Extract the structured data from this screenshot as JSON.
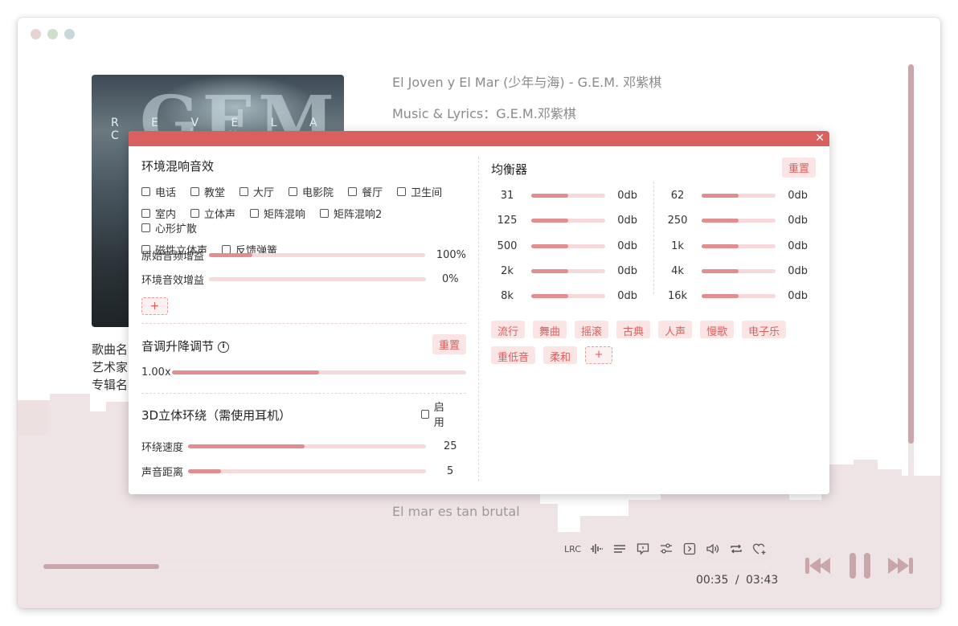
{
  "window": {
    "traffic_colors": [
      "#e8d3d3",
      "#cde0c9",
      "#c5d8dc"
    ]
  },
  "cover": {
    "text": "R E V E L A C I Ó N",
    "big_text": "GEM"
  },
  "track_info": {
    "song_label": "歌曲名",
    "artist_label": "艺术家",
    "album_label": "专辑名"
  },
  "lyrics": {
    "title_line": "El Joven y El Mar (少年与海) - G.E.M. 邓紫棋",
    "credit_line": "Music & Lyrics：G.E.M.邓紫棋",
    "current_line": "El mar es tan brutal"
  },
  "toolbar": {
    "lrc_label": "LRC",
    "icons": [
      "waveform-icon",
      "lines-icon",
      "comment-icon",
      "sliders-icon",
      "chevron-box-icon",
      "volume-icon",
      "repeat-icon",
      "heart-add-icon"
    ]
  },
  "playback": {
    "progress": 0.16,
    "current_time": "00:35",
    "separator": "/",
    "total_time": "03:43",
    "prev_label": "previous",
    "pause_label": "pause",
    "next_label": "next"
  },
  "colors": {
    "accent": "#d9605f",
    "accent_light": "#fbe4e4",
    "slider_fill": "#e28d8f",
    "track": "#f6d9da",
    "muted": "#c9a6aa"
  },
  "dialog": {
    "ambient": {
      "title": "环境混响音效",
      "effects": [
        [
          "电话",
          "教堂",
          "大厅",
          "电影院",
          "餐厅",
          "卫生间"
        ],
        [
          "室内",
          "立体声",
          "矩阵混响",
          "矩阵混响2",
          "心形扩散"
        ],
        [
          "磁性立体声",
          "反馈弹簧"
        ]
      ],
      "original_gain_label": "原始音频增益",
      "original_gain_value": "100%",
      "original_gain": 0.2,
      "effect_gain_label": "环境音效增益",
      "effect_gain_value": "0%",
      "effect_gain": 0,
      "add_label": "+"
    },
    "pitch": {
      "title": "音调升降调节",
      "info_glyph": "i",
      "reset_label": "重置",
      "value_label": "1.00x",
      "level": 0.5
    },
    "surround": {
      "title": "3D立体环绕（需使用耳机）",
      "enable_label": "启用",
      "speed_label": "环绕速度",
      "speed_value": "25",
      "speed_level": 0.49,
      "distance_label": "声音距离",
      "distance_value": "5",
      "distance_level": 0.14
    },
    "equalizer": {
      "title": "均衡器",
      "reset_label": "重置",
      "left": [
        {
          "freq": "31",
          "value": "0db"
        },
        {
          "freq": "125",
          "value": "0db"
        },
        {
          "freq": "500",
          "value": "0db"
        },
        {
          "freq": "2k",
          "value": "0db"
        },
        {
          "freq": "8k",
          "value": "0db"
        }
      ],
      "right": [
        {
          "freq": "62",
          "value": "0db"
        },
        {
          "freq": "250",
          "value": "0db"
        },
        {
          "freq": "1k",
          "value": "0db"
        },
        {
          "freq": "4k",
          "value": "0db"
        },
        {
          "freq": "16k",
          "value": "0db"
        }
      ],
      "presets": [
        "流行",
        "舞曲",
        "摇滚",
        "古典",
        "人声",
        "慢歌",
        "电子乐",
        "重低音",
        "柔和"
      ],
      "add_label": "+"
    }
  }
}
